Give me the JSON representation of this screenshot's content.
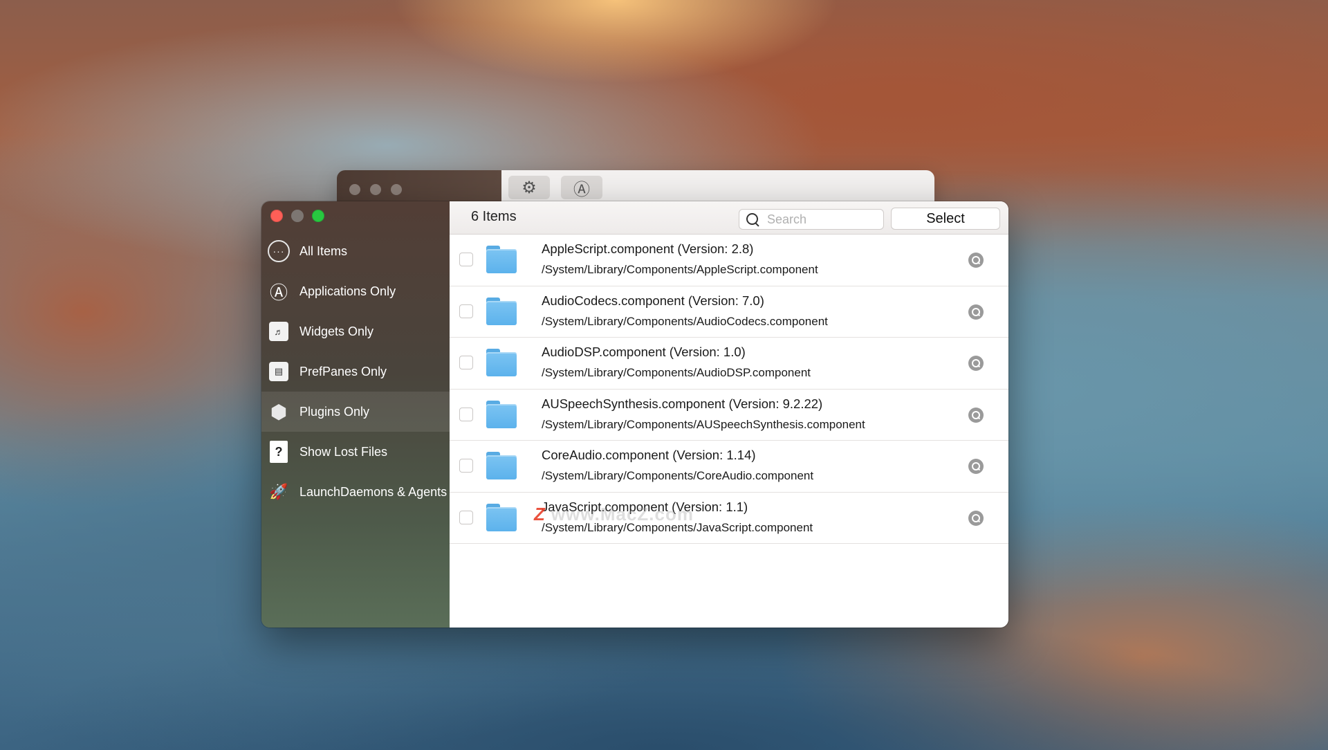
{
  "back_window": {
    "tools": [
      {
        "icon": "gear-icon",
        "glyph": "⚙"
      },
      {
        "icon": "app-store-icon",
        "glyph": "Ⓐ"
      }
    ]
  },
  "window": {
    "traffic_lights": [
      "close",
      "minimize",
      "zoom"
    ]
  },
  "sidebar": {
    "items": [
      {
        "label": "All Items",
        "icon": "ellipsis-circle-icon",
        "glyph": "···",
        "selected": false
      },
      {
        "label": "Applications Only",
        "icon": "app-store-icon",
        "glyph": "Ⓐ",
        "selected": false
      },
      {
        "label": "Widgets Only",
        "icon": "widgets-icon",
        "glyph": "♬",
        "selected": false
      },
      {
        "label": "PrefPanes Only",
        "icon": "prefpane-icon",
        "glyph": "▤",
        "selected": false
      },
      {
        "label": "Plugins Only",
        "icon": "plugin-cube-icon",
        "glyph": "⬢",
        "selected": true
      },
      {
        "label": "Show Lost Files",
        "icon": "question-document-icon",
        "glyph": "?",
        "selected": false
      },
      {
        "label": "LaunchDaemons & Agents",
        "icon": "rocket-icon",
        "glyph": "🚀",
        "selected": false
      }
    ]
  },
  "header": {
    "item_count": "6 Items",
    "search_placeholder": "Search",
    "select_label": "Select"
  },
  "items": [
    {
      "title": "AppleScript.component (Version: 2.8)",
      "path": "/System/Library/Components/AppleScript.component"
    },
    {
      "title": "AudioCodecs.component (Version: 7.0)",
      "path": "/System/Library/Components/AudioCodecs.component"
    },
    {
      "title": "AudioDSP.component (Version: 1.0)",
      "path": "/System/Library/Components/AudioDSP.component"
    },
    {
      "title": "AUSpeechSynthesis.component (Version: 9.2.22)",
      "path": "/System/Library/Components/AUSpeechSynthesis.component"
    },
    {
      "title": "CoreAudio.component (Version: 1.14)",
      "path": "/System/Library/Components/CoreAudio.component"
    },
    {
      "title": "JavaScript.component (Version: 1.1)",
      "path": "/System/Library/Components/JavaScript.component"
    }
  ],
  "watermark": {
    "mark": "Z",
    "text": "www.MacZ.com"
  },
  "colors": {
    "close": "#ff5f57",
    "zoom": "#28c840",
    "folder": "#5cb2ec",
    "accent_selected": "rgba(255,255,255,0.09)"
  }
}
